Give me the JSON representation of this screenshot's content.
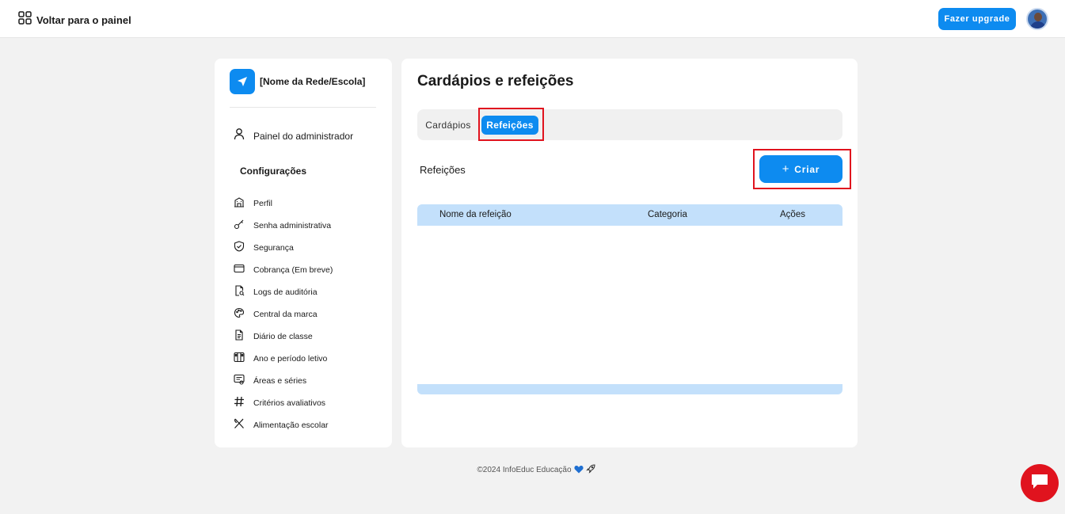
{
  "topbar": {
    "back_label": "Voltar para o painel",
    "upgrade_label": "Fazer upgrade"
  },
  "sidebar": {
    "brand_name": "[Nome da Rede/Escola]",
    "admin_label": "Painel do administrador",
    "section_title": "Configurações",
    "items": [
      {
        "label": "Perfil",
        "icon": "building-icon"
      },
      {
        "label": "Senha administrativa",
        "icon": "key-icon"
      },
      {
        "label": "Segurança",
        "icon": "shield-icon"
      },
      {
        "label": "Cobrança (Em breve)",
        "icon": "wallet-icon"
      },
      {
        "label": "Logs de auditória",
        "icon": "file-search-icon"
      },
      {
        "label": "Central da marca",
        "icon": "palette-icon"
      },
      {
        "label": "Diário de classe",
        "icon": "document-icon"
      },
      {
        "label": "Ano e período letivo",
        "icon": "calendar-columns-icon"
      },
      {
        "label": "Áreas e séries",
        "icon": "areas-icon"
      },
      {
        "label": "Critérios avaliativos",
        "icon": "hash-icon"
      },
      {
        "label": "Alimentação escolar",
        "icon": "utensils-icon"
      }
    ]
  },
  "main": {
    "title": "Cardápios e refeições",
    "tabs": [
      {
        "label": "Cardápios",
        "active": false
      },
      {
        "label": "Refeições",
        "active": true
      }
    ],
    "section_label": "Refeições",
    "create_label": "Criar",
    "table": {
      "columns": [
        "Nome da refeição",
        "Categoria",
        "Ações"
      ],
      "rows": []
    }
  },
  "footer": {
    "text": "©2024 InfoEduc Educação"
  },
  "colors": {
    "accent": "#0d8bf0",
    "highlight": "#e0131e",
    "table_header": "#c3e0fb"
  }
}
